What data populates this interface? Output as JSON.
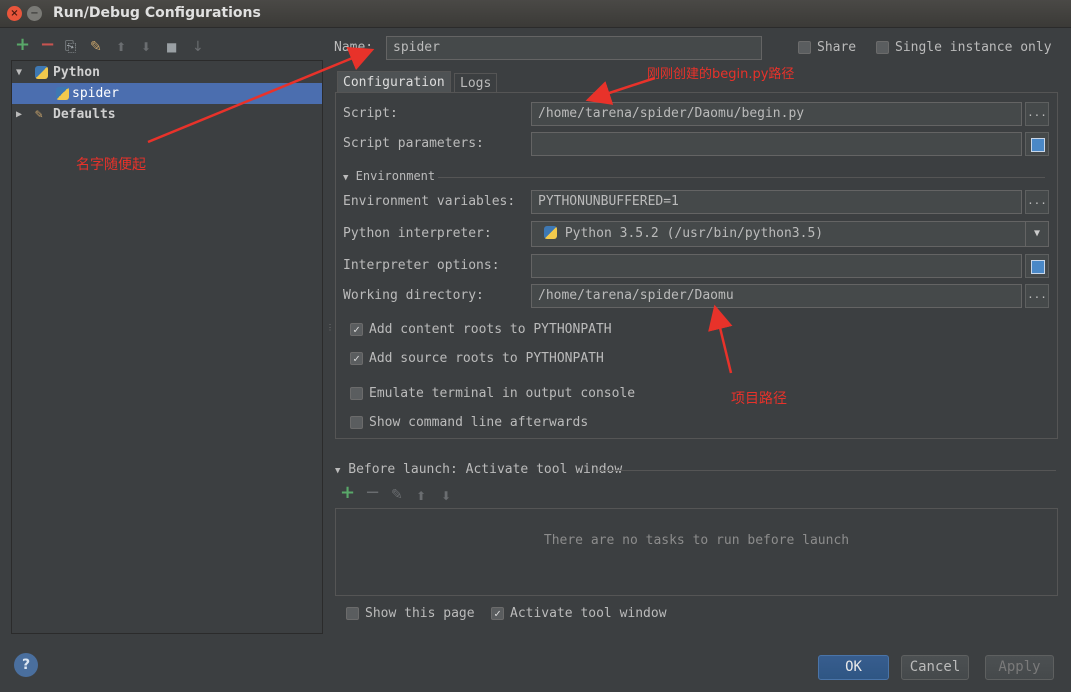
{
  "window": {
    "title": "Run/Debug Configurations",
    "close_glyph": "×",
    "min_glyph": "−"
  },
  "toolbar": {
    "icons": [
      "add-icon",
      "remove-icon",
      "copy-icon",
      "edit-defaults-icon",
      "move-up-icon",
      "move-down-icon",
      "folder-icon",
      "sort-icon"
    ],
    "add_glyph": "+",
    "remove_glyph": "−",
    "up_glyph": "⬆",
    "down_glyph": "⬇",
    "copy_glyph": "⎘",
    "wrench_glyph": "✎",
    "folder_glyph": "■",
    "sort_glyph": "↓"
  },
  "tree": {
    "python_label": "Python",
    "spider_label": "spider",
    "defaults_label": "Defaults",
    "expand_glyph": "▼",
    "collapsed_glyph": "▶"
  },
  "header": {
    "name_label": "Name:",
    "name_value": "spider",
    "share_label": "Share",
    "single_instance_label": "Single instance only"
  },
  "tabs": [
    "Configuration",
    "Logs"
  ],
  "config": {
    "script_label": "Script:",
    "script_value": "/home/tarena/spider/Daomu/begin.py",
    "script_params_label": "Script parameters:",
    "script_params_value": "",
    "environment_section": "Environment",
    "env_vars_label": "Environment variables:",
    "env_vars_value": "PYTHONUNBUFFERED=1",
    "interpreter_label": "Python interpreter:",
    "interpreter_value": "Python 3.5.2 (/usr/bin/python3.5)",
    "interp_options_label": "Interpreter options:",
    "interp_options_value": "",
    "workdir_label": "Working directory:",
    "workdir_value": "/home/tarena/spider/Daomu",
    "browse_glyph": "...",
    "dropdown_glyph": "▼",
    "check_glyph": "✓",
    "add_content_roots": "Add content roots to PYTHONPATH",
    "add_source_roots": "Add source roots to PYTHONPATH",
    "emulate_terminal": "Emulate terminal in output console",
    "show_cmd": "Show command line afterwards"
  },
  "before_launch": {
    "title": "Before launch: Activate tool window",
    "empty_text": "There are no tasks to run before launch",
    "show_page": "Show this page",
    "activate_tool_window": "Activate tool window"
  },
  "buttons": {
    "ok": "OK",
    "cancel": "Cancel",
    "apply": "Apply",
    "help": "?"
  },
  "annotations": {
    "name_note": "名字随便起",
    "script_note": "刚刚创建的begin.py路径",
    "workdir_note": "项目路径",
    "color": "#e8322a"
  },
  "colors": {
    "selection": "#4b6eaf",
    "accent_add": "#59a869",
    "accent_remove": "#c75450"
  }
}
